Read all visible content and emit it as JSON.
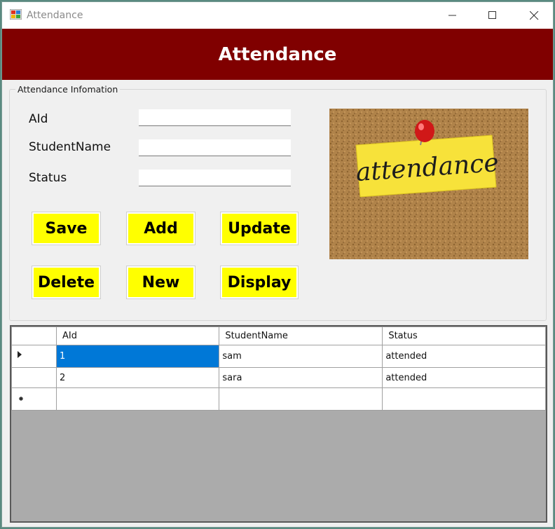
{
  "window": {
    "title": "Attendance",
    "header_title": "Attendance"
  },
  "group": {
    "legend": "Attendance Infomation"
  },
  "fields": {
    "aid_label": "AId",
    "name_label": "StudentName",
    "status_label": "Status",
    "aid_value": "",
    "name_value": "",
    "status_value": ""
  },
  "buttons": {
    "save": "Save",
    "add": "Add",
    "update": "Update",
    "delete": "Delete",
    "new": "New",
    "display": "Display"
  },
  "image": {
    "note_text": "attendance"
  },
  "grid": {
    "columns": [
      "AId",
      "StudentName",
      "Status"
    ],
    "rows": [
      {
        "aid": "1",
        "name": "sam",
        "status": "attended"
      },
      {
        "aid": "2",
        "name": "sara",
        "status": "attended"
      }
    ]
  },
  "colors": {
    "header_band": "#800000",
    "button_fill": "#ffff00",
    "selection": "#0078d7"
  }
}
